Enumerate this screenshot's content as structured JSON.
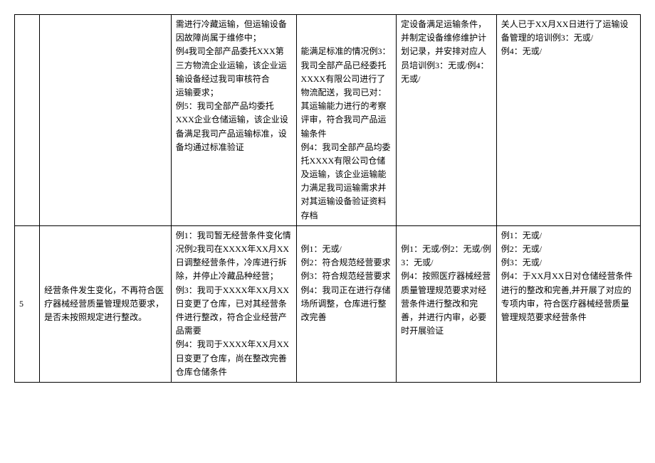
{
  "rows": [
    {
      "num": "",
      "desc": "",
      "c3": "需进行冷藏运输，但运输设备因故障尚属于维修中；\n例4我司全部产品委托XXX第三方物流企业运输，该企业运输设备经过我司审核符合\n运输要求；\n例5：我司全部产品均委托XXX企业仓储运输，该企业设备满足我司产品运输标准，设备均通过标准验证",
      "c4": "\n\n能满足标准的情况例3：我司全部产品已经委托XXXX有限公司进行了物流配送，我司已对：其运输能力进行的考察评审，符合我司产品运输条件\n例4：我司全部产品均委托XXXX有限公司仓储及运输，该企业运输能力满足我司运输需求并对其运输设备验证资料存档",
      "c5": "定设备满足运输条件，并制定设备维修维护计划记录，并安排对应人员培训例3：无或/例4：无或/",
      "c6": "关人已于XX月XX日进行了运输设备管理的培训例3：无或/\n例4：无或/"
    },
    {
      "num": "5",
      "desc": "经营条件发生变化，不再符合医疗器械经营质量管理规范要求，是否未按照规定进行整改。",
      "c3": "例1：我司暂无经营条件变化情况例2我司在XXXX年XX月XX日调整经营条件，冷库进行拆除，并停止冷藏品种经营；\n例3：我司于XXXX年XX月XX日变更了仓库，已对其经营条件进行整改，符合企业经营产品需要\n例4：我司于XXXX年XX月XX日变更了仓库，尚在整改完善仓库仓储条件",
      "c4": "\n例1：无或/\n例2：符合规范经营要求\n例3：符合规范经营要求\n例4：我司正在进行存储场所调整，仓库进行整改完善",
      "c5": "\n例1：无或/例2：无或/例3：无或/\n例4：按照医疗器械经营质量管理规范要求对经营条件进行整改和完善，并进行内审，必要时开展验证",
      "c6": "例1：无或/\n例2：无或/\n例3：无或/\n例4：于XX月XX日对仓储经营条件进行的整改和完善,并开展了对应的专项内审，符合医疗器械经营质量管理规范要求经营条件"
    }
  ]
}
